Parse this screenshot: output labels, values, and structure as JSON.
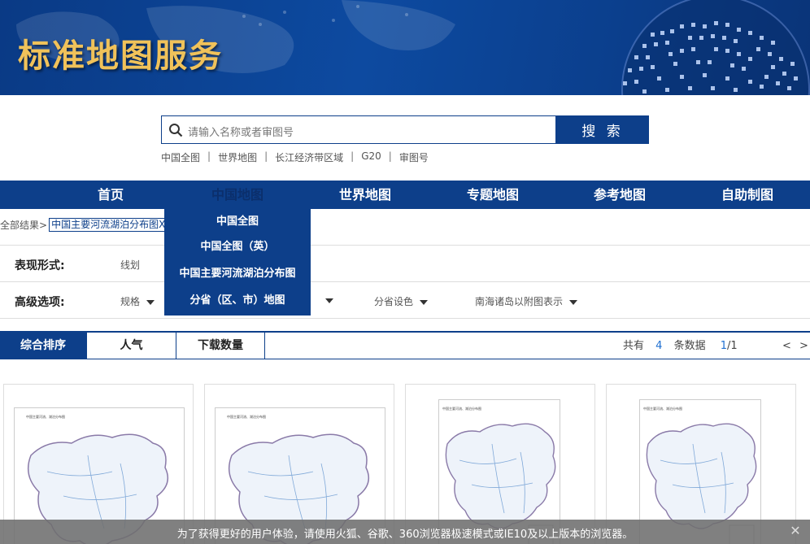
{
  "banner": {
    "title": "标准地图服务"
  },
  "search": {
    "placeholder": "请输入名称或者审图号",
    "button": "搜 索"
  },
  "quick_links": [
    "中国全图",
    "世界地图",
    "长江经济带区域",
    "G20",
    "审图号"
  ],
  "nav": {
    "items": [
      {
        "label": "首页"
      },
      {
        "label": "中国地图"
      },
      {
        "label": "世界地图"
      },
      {
        "label": "专题地图"
      },
      {
        "label": "参考地图"
      },
      {
        "label": "自助制图"
      }
    ],
    "active": "中国地图"
  },
  "dropdown": {
    "items": [
      "中国全图",
      "中国全图（英）",
      "中国主要河流湖泊分布图",
      "分省（区、市）地图"
    ]
  },
  "breadcrumb": {
    "root": "全部结果>",
    "tag": "中国主要河流湖泊分布图X"
  },
  "filters": {
    "form_label": "表现形式:",
    "form_value": "线划",
    "advanced_label": "高级选项:",
    "advanced_options": [
      "规格",
      "分省设色",
      "南海诸岛以附图表示"
    ]
  },
  "sort": {
    "tabs": [
      "综合排序",
      "人气",
      "下载数量"
    ],
    "active": "综合排序",
    "total_prefix": "共有",
    "total": "4",
    "total_suffix": "条数据",
    "page_current": "1",
    "page_total": "/1",
    "prev": "<",
    "next": ">"
  },
  "cards": [
    {
      "caption": "中国主要河流、湖泊分布图"
    },
    {
      "caption": "中国主要河流、湖泊分布图"
    },
    {
      "caption": "中国主要河流、湖泊分布图"
    },
    {
      "caption": "中国主要河流、湖泊分布图"
    }
  ],
  "notice": {
    "message": "为了获得更好的用户体验，请使用火狐、谷歌、360浏览器极速模式或IE10及以上版本的浏览器。",
    "close": "✕"
  },
  "colors": {
    "primary": "#0d3f8a",
    "banner_title": "#f0c25a",
    "link_blue": "#1f6fd1"
  }
}
